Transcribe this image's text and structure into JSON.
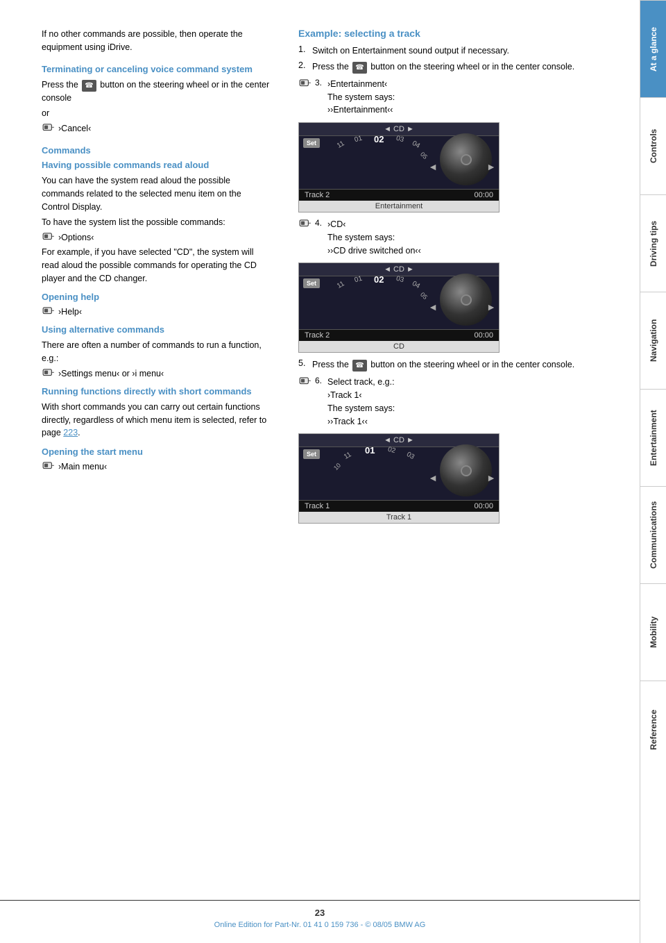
{
  "page": {
    "number": "23",
    "footer_text": "Online Edition for Part-Nr. 01 41 0 159 736 - © 08/05 BMW AG"
  },
  "sidebar": {
    "tabs": [
      {
        "label": "At a glance",
        "active": true
      },
      {
        "label": "Controls",
        "active": false
      },
      {
        "label": "Driving tips",
        "active": false
      },
      {
        "label": "Navigation",
        "active": false
      },
      {
        "label": "Entertainment",
        "active": false
      },
      {
        "label": "Communications",
        "active": false
      },
      {
        "label": "Mobility",
        "active": false
      },
      {
        "label": "Reference",
        "active": false
      }
    ]
  },
  "left": {
    "intro_text": "If no other commands are possible, then operate the equipment using iDrive.",
    "section1": {
      "heading": "Terminating or canceling voice command system",
      "text1": "Press the",
      "text2": "button on the steering wheel or in the center console",
      "or_text": "or",
      "command": "›Cancel‹"
    },
    "section2": {
      "heading": "Commands",
      "subsection1": {
        "heading": "Having possible commands read aloud",
        "text": "You can have the system read aloud the possible commands related to the selected menu item on the Control Display.",
        "text2": "To have the system list the possible commands:",
        "command": "›Options‹",
        "text3": "For example, if you have selected \"CD\", the system will read aloud the possible commands for operating the CD player and the CD changer."
      },
      "subsection2": {
        "heading": "Opening help",
        "command": "›Help‹"
      },
      "subsection3": {
        "heading": "Using alternative commands",
        "text": "There are often a number of commands to run a function, e.g.:",
        "command": "›Settings menu‹ or ›i menu‹"
      },
      "subsection4": {
        "heading": "Running functions directly with short commands",
        "text": "With short commands you can carry out certain functions directly, regardless of which menu item is selected, refer to page",
        "page_ref": "223",
        "text_end": "."
      },
      "subsection5": {
        "heading": "Opening the start menu",
        "command": "›Main menu‹"
      }
    }
  },
  "right": {
    "example_heading": "Example: selecting a track",
    "steps": [
      {
        "num": "1.",
        "text": "Switch on Entertainment sound output if necessary.",
        "has_mic": false
      },
      {
        "num": "2.",
        "text": "Press the",
        "text2": "button on the steering wheel or in the center console.",
        "has_btn": true,
        "has_mic": false
      },
      {
        "num": "3.",
        "command": "›Entertainment‹",
        "system_says": "The system says:",
        "system_response": "››Entertainment‹‹",
        "has_mic": true,
        "display": "1"
      },
      {
        "num": "4.",
        "command": "›CD‹",
        "system_says": "The system says:",
        "system_response": "››CD drive switched on‹‹",
        "has_mic": true,
        "display": "2"
      },
      {
        "num": "5.",
        "text": "Press the",
        "text2": "button on the steering wheel or in the center console.",
        "has_btn": true,
        "has_mic": false
      },
      {
        "num": "6.",
        "text": "Select track, e.g.:",
        "command": "›Track 1‹",
        "system_says": "The system says:",
        "system_response": "››Track 1‹‹",
        "has_mic": true,
        "display": "3"
      }
    ],
    "displays": [
      {
        "id": "1",
        "top_label": "◄  CD  ►",
        "active_track": "02",
        "track_nums": [
          "11",
          "01",
          "02",
          "03",
          "04",
          "05"
        ],
        "bottom_track": "Track 2",
        "time": "00:00",
        "label": "Entertainment"
      },
      {
        "id": "2",
        "top_label": "◄  CD  ►",
        "active_track": "02",
        "track_nums": [
          "11",
          "01",
          "02",
          "03",
          "04",
          "05"
        ],
        "bottom_track": "Track 2",
        "time": "00:00",
        "label": "CD"
      },
      {
        "id": "3",
        "top_label": "◄  CD  ►",
        "active_track": "01",
        "track_nums": [
          "10",
          "11",
          "01",
          "02",
          "03"
        ],
        "bottom_track": "Track 1",
        "time": "00:00",
        "label": "Track 1"
      }
    ]
  }
}
